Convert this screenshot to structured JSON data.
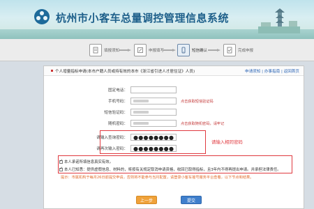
{
  "banner": {
    "title": "杭州市小客车总量调控管理信息系统",
    "logo_icon": "hangzhou-logo-icon",
    "scenery_icon": "pagoda-scenery-icon"
  },
  "steps": [
    {
      "label": "填报须知",
      "icon": "document-icon",
      "active": false
    },
    {
      "label": "申报填写",
      "icon": "form-edit-icon",
      "active": false
    },
    {
      "label": "短信确认",
      "icon": "phone-message-icon",
      "active": true
    },
    {
      "label": "完成申报",
      "icon": "check-document-icon",
      "active": false
    }
  ],
  "panel": {
    "title": "个人增量指标申请(本市户籍人员或持有效的本市《浙江省引进人才居住证》人员)",
    "links": "申请须知 | 办事指南 | 返回首页"
  },
  "form": {
    "fixed_phone_label": "固定电话：",
    "mobile_label": "手机号码：",
    "mobile_note": "点击获取短信验证码",
    "sms_code_label": "短信验证码：",
    "sms_code_value": "",
    "dynamic_pwd_label": "随机密码：",
    "dynamic_pwd_note": "点击获取随机密码，请牢记",
    "query_pwd_label": "请输入查询密码：",
    "query_pwd_value": "●●●●●●●●",
    "query_pwd_confirm_label": "请再次输入密码：",
    "query_pwd_confirm_value": "●●●●●●●●",
    "annotation": "请输入相同密码"
  },
  "checks": {
    "item1": "本人承诺所填信息真实有效。",
    "item2": "本人已知悉：提供虚假信息、材料的，将按有关规定取消申请资格，收回已取得指标，且3年内不得再提出申请。并承担法律责任。"
  },
  "tip": "提示：市属机构于每月26日前提交申请，否则将不能参与当月配置，请登录小客车摇号服务平台查看，以下节点和结果。",
  "buttons": {
    "prev": "上一步",
    "submit": "提交"
  },
  "colors": {
    "accent_blue": "#3f7fcc",
    "prev_orange": "#f0a23a",
    "annotation_red": "#e0393f"
  }
}
